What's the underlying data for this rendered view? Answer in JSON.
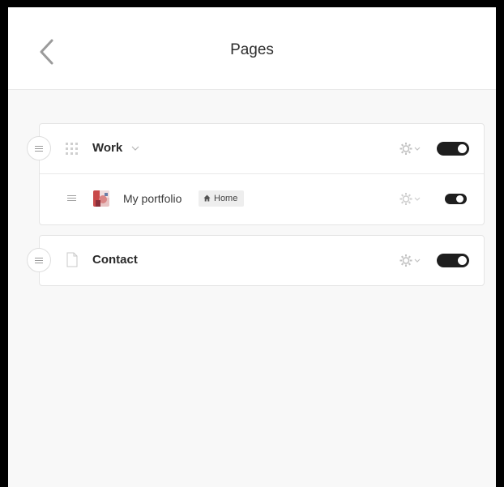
{
  "header": {
    "title": "Pages"
  },
  "pages": {
    "work": {
      "label": "Work",
      "enabled": true
    },
    "portfolio": {
      "label": "My portfolio",
      "badge": "Home",
      "enabled": true
    },
    "contact": {
      "label": "Contact",
      "enabled": true
    }
  },
  "icons": {
    "back": "chevron-left-icon",
    "drag": "drag-handle-icon",
    "grid": "grid-icon",
    "document": "document-icon",
    "gear": "gear-icon",
    "home": "home-icon"
  },
  "colors": {
    "background": "#f8f8f8",
    "card": "#ffffff",
    "toggle_on": "#1e1e1e"
  }
}
